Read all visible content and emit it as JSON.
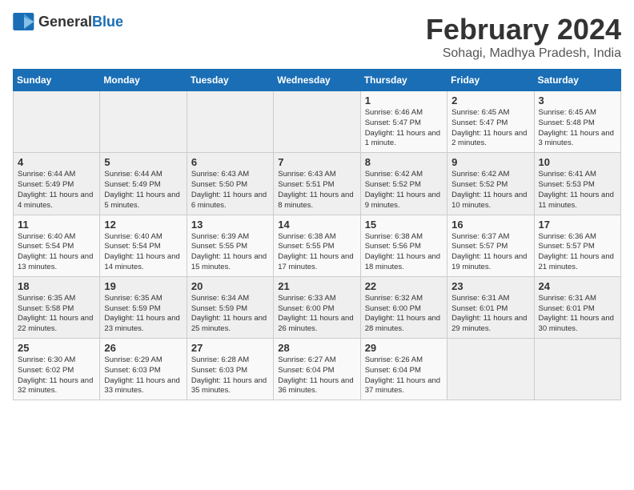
{
  "logo": {
    "general": "General",
    "blue": "Blue"
  },
  "title": "February 2024",
  "subtitle": "Sohagi, Madhya Pradesh, India",
  "days_of_week": [
    "Sunday",
    "Monday",
    "Tuesday",
    "Wednesday",
    "Thursday",
    "Friday",
    "Saturday"
  ],
  "weeks": [
    [
      {
        "day": "",
        "info": ""
      },
      {
        "day": "",
        "info": ""
      },
      {
        "day": "",
        "info": ""
      },
      {
        "day": "",
        "info": ""
      },
      {
        "day": "1",
        "info": "Sunrise: 6:46 AM\nSunset: 5:47 PM\nDaylight: 11 hours and 1 minute."
      },
      {
        "day": "2",
        "info": "Sunrise: 6:45 AM\nSunset: 5:47 PM\nDaylight: 11 hours and 2 minutes."
      },
      {
        "day": "3",
        "info": "Sunrise: 6:45 AM\nSunset: 5:48 PM\nDaylight: 11 hours and 3 minutes."
      }
    ],
    [
      {
        "day": "4",
        "info": "Sunrise: 6:44 AM\nSunset: 5:49 PM\nDaylight: 11 hours and 4 minutes."
      },
      {
        "day": "5",
        "info": "Sunrise: 6:44 AM\nSunset: 5:49 PM\nDaylight: 11 hours and 5 minutes."
      },
      {
        "day": "6",
        "info": "Sunrise: 6:43 AM\nSunset: 5:50 PM\nDaylight: 11 hours and 6 minutes."
      },
      {
        "day": "7",
        "info": "Sunrise: 6:43 AM\nSunset: 5:51 PM\nDaylight: 11 hours and 8 minutes."
      },
      {
        "day": "8",
        "info": "Sunrise: 6:42 AM\nSunset: 5:52 PM\nDaylight: 11 hours and 9 minutes."
      },
      {
        "day": "9",
        "info": "Sunrise: 6:42 AM\nSunset: 5:52 PM\nDaylight: 11 hours and 10 minutes."
      },
      {
        "day": "10",
        "info": "Sunrise: 6:41 AM\nSunset: 5:53 PM\nDaylight: 11 hours and 11 minutes."
      }
    ],
    [
      {
        "day": "11",
        "info": "Sunrise: 6:40 AM\nSunset: 5:54 PM\nDaylight: 11 hours and 13 minutes."
      },
      {
        "day": "12",
        "info": "Sunrise: 6:40 AM\nSunset: 5:54 PM\nDaylight: 11 hours and 14 minutes."
      },
      {
        "day": "13",
        "info": "Sunrise: 6:39 AM\nSunset: 5:55 PM\nDaylight: 11 hours and 15 minutes."
      },
      {
        "day": "14",
        "info": "Sunrise: 6:38 AM\nSunset: 5:55 PM\nDaylight: 11 hours and 17 minutes."
      },
      {
        "day": "15",
        "info": "Sunrise: 6:38 AM\nSunset: 5:56 PM\nDaylight: 11 hours and 18 minutes."
      },
      {
        "day": "16",
        "info": "Sunrise: 6:37 AM\nSunset: 5:57 PM\nDaylight: 11 hours and 19 minutes."
      },
      {
        "day": "17",
        "info": "Sunrise: 6:36 AM\nSunset: 5:57 PM\nDaylight: 11 hours and 21 minutes."
      }
    ],
    [
      {
        "day": "18",
        "info": "Sunrise: 6:35 AM\nSunset: 5:58 PM\nDaylight: 11 hours and 22 minutes."
      },
      {
        "day": "19",
        "info": "Sunrise: 6:35 AM\nSunset: 5:59 PM\nDaylight: 11 hours and 23 minutes."
      },
      {
        "day": "20",
        "info": "Sunrise: 6:34 AM\nSunset: 5:59 PM\nDaylight: 11 hours and 25 minutes."
      },
      {
        "day": "21",
        "info": "Sunrise: 6:33 AM\nSunset: 6:00 PM\nDaylight: 11 hours and 26 minutes."
      },
      {
        "day": "22",
        "info": "Sunrise: 6:32 AM\nSunset: 6:00 PM\nDaylight: 11 hours and 28 minutes."
      },
      {
        "day": "23",
        "info": "Sunrise: 6:31 AM\nSunset: 6:01 PM\nDaylight: 11 hours and 29 minutes."
      },
      {
        "day": "24",
        "info": "Sunrise: 6:31 AM\nSunset: 6:01 PM\nDaylight: 11 hours and 30 minutes."
      }
    ],
    [
      {
        "day": "25",
        "info": "Sunrise: 6:30 AM\nSunset: 6:02 PM\nDaylight: 11 hours and 32 minutes."
      },
      {
        "day": "26",
        "info": "Sunrise: 6:29 AM\nSunset: 6:03 PM\nDaylight: 11 hours and 33 minutes."
      },
      {
        "day": "27",
        "info": "Sunrise: 6:28 AM\nSunset: 6:03 PM\nDaylight: 11 hours and 35 minutes."
      },
      {
        "day": "28",
        "info": "Sunrise: 6:27 AM\nSunset: 6:04 PM\nDaylight: 11 hours and 36 minutes."
      },
      {
        "day": "29",
        "info": "Sunrise: 6:26 AM\nSunset: 6:04 PM\nDaylight: 11 hours and 37 minutes."
      },
      {
        "day": "",
        "info": ""
      },
      {
        "day": "",
        "info": ""
      }
    ]
  ]
}
